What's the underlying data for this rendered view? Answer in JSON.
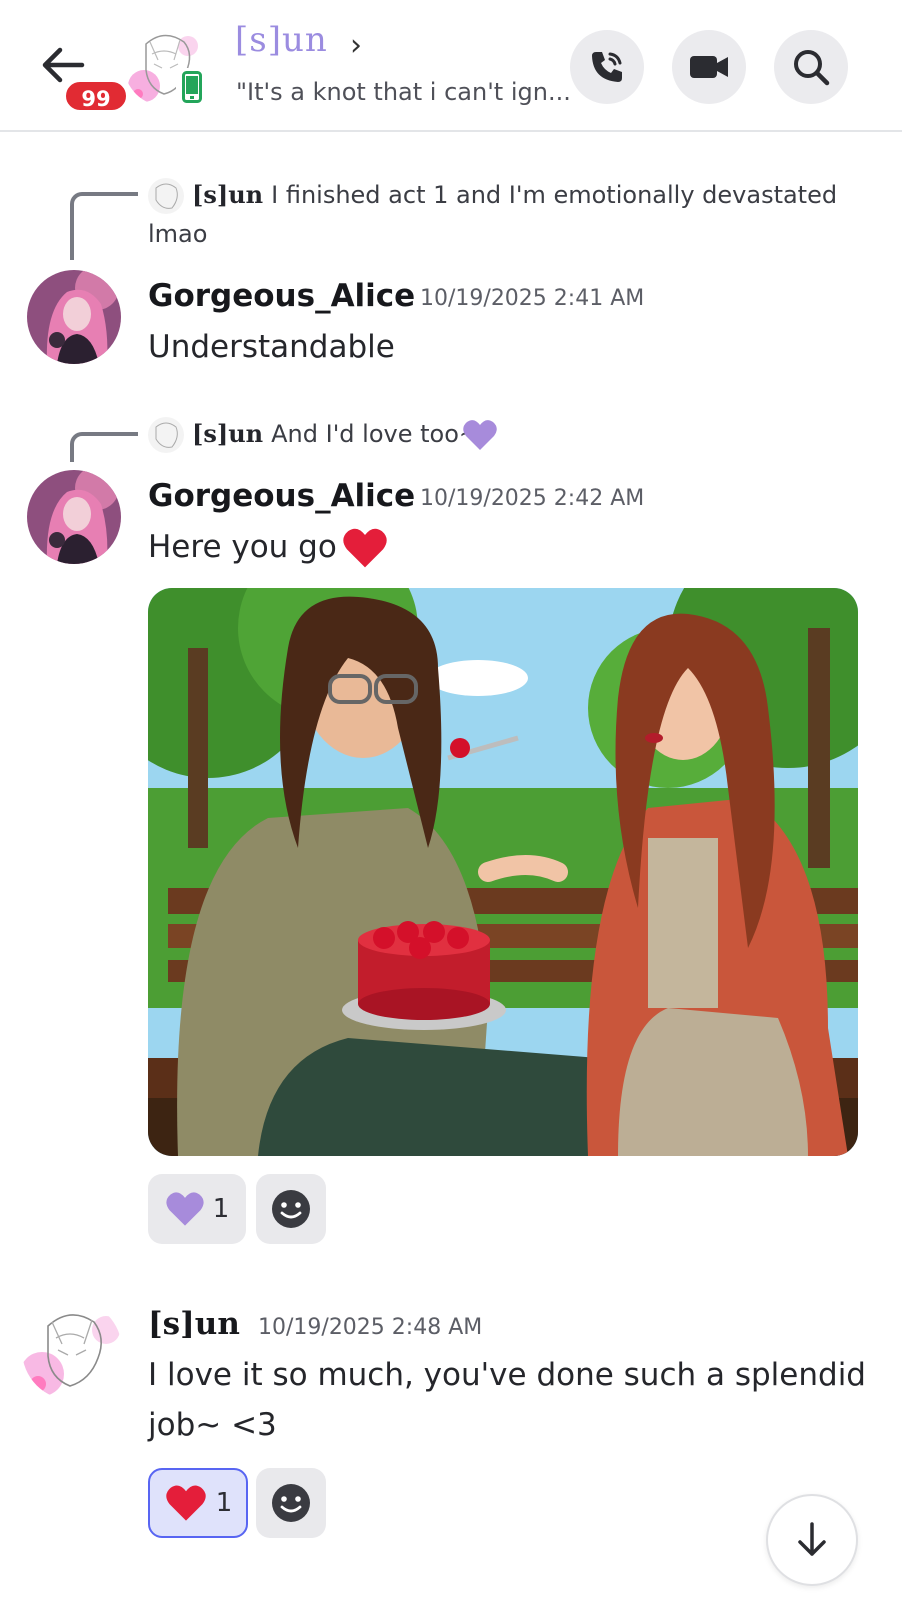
{
  "header": {
    "badge_count": "99",
    "channel_name": "[s]un",
    "chevron": "›",
    "status_text": "\"It's a knot that i can't ign...",
    "icons": [
      "back-arrow-icon",
      "mobile-status-icon",
      "phone-call-icon",
      "video-camera-icon",
      "search-icon"
    ]
  },
  "messages": [
    {
      "reply": {
        "author": "[s]un",
        "text": "I finished act 1 and I'm emotionally devastated",
        "text_cont": "lmao"
      },
      "author": "Gorgeous_Alice",
      "timestamp": "10/19/2025 2:41 AM",
      "text": "Understandable"
    },
    {
      "reply": {
        "author": "[s]un",
        "text": "And I'd love too~",
        "emoji": "purple-heart"
      },
      "author": "Gorgeous_Alice",
      "timestamp": "10/19/2025 2:42 AM",
      "text": "Here you go",
      "emoji": "red-heart",
      "attachment": "park-bench-cake-illustration",
      "reactions": [
        {
          "emoji": "purple-heart",
          "count": "1",
          "active": false
        }
      ]
    },
    {
      "author": "[s]un",
      "timestamp": "10/19/2025 2:48 AM",
      "text_line1": "I love it so much, you've done such a splendid",
      "text_line2": "job~ <3",
      "reactions": [
        {
          "emoji": "red-heart",
          "count": "1",
          "active": true
        }
      ]
    }
  ],
  "colors": {
    "accent": "#5865f2",
    "badge": "#e12b33",
    "purple_heart": "#a78bdb",
    "red_heart": "#e41e3a",
    "sun_name": "#9b8ce0"
  }
}
